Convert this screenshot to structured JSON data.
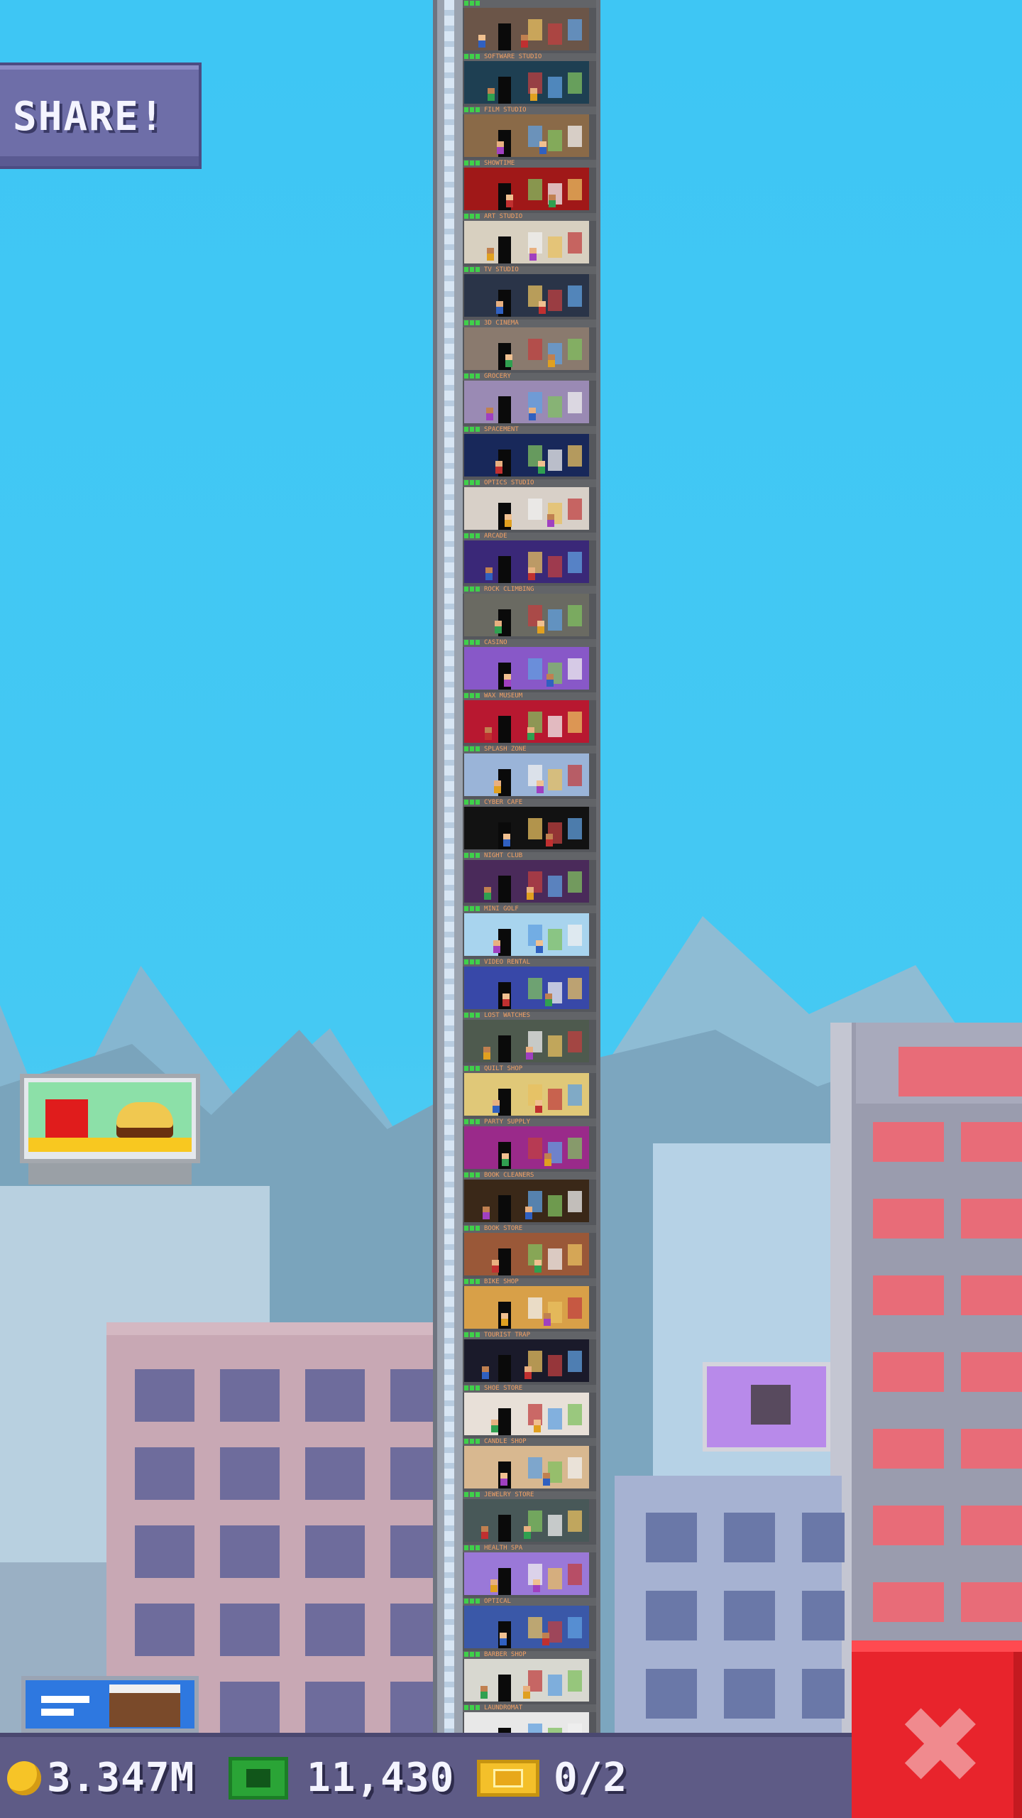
{
  "share_button": {
    "label": "SHARE!"
  },
  "tower": {
    "floors": [
      {
        "name": "",
        "color": "#6b5548"
      },
      {
        "name": "SOFTWARE STUDIO",
        "color": "#1e3f52"
      },
      {
        "name": "FILM STUDIO",
        "color": "#8a6a48"
      },
      {
        "name": "SHOWTIME",
        "color": "#a01818"
      },
      {
        "name": "ART STUDIO",
        "color": "#d8d0c0"
      },
      {
        "name": "TV STUDIO",
        "color": "#2a3448"
      },
      {
        "name": "3D CINEMA",
        "color": "#8a7a6e"
      },
      {
        "name": "GROCERY",
        "color": "#9a8ab4"
      },
      {
        "name": "SPACEMENT",
        "color": "#18285a"
      },
      {
        "name": "OPTICS STUDIO",
        "color": "#d8d0c8"
      },
      {
        "name": "ARCADE",
        "color": "#3a2878"
      },
      {
        "name": "ROCK CLIMBING",
        "color": "#6a6a62"
      },
      {
        "name": "CASINO",
        "color": "#8858c8"
      },
      {
        "name": "WAX MUSEUM",
        "color": "#b81830"
      },
      {
        "name": "SPLASH ZONE",
        "color": "#9ab4d8"
      },
      {
        "name": "CYBER CAFE",
        "color": "#121212"
      },
      {
        "name": "NIGHT CLUB",
        "color": "#4a2a5a"
      },
      {
        "name": "MINI GOLF",
        "color": "#a8d4ee"
      },
      {
        "name": "VIDEO RENTAL",
        "color": "#3848a8"
      },
      {
        "name": "LOST WATCHES",
        "color": "#4e5a4e"
      },
      {
        "name": "QUILT SHOP",
        "color": "#e0c878"
      },
      {
        "name": "PARTY SUPPLY",
        "color": "#9a2a8a"
      },
      {
        "name": "BOOK CLEANERS",
        "color": "#3a2818"
      },
      {
        "name": "BOOK STORE",
        "color": "#9a5838"
      },
      {
        "name": "BIKE SHOP",
        "color": "#d8a048"
      },
      {
        "name": "TOURIST TRAP",
        "color": "#1a1a2a"
      },
      {
        "name": "SHOE STORE",
        "color": "#e8e0d8"
      },
      {
        "name": "CANDLE SHOP",
        "color": "#d8b890"
      },
      {
        "name": "JEWELRY STORE",
        "color": "#485858"
      },
      {
        "name": "HEALTH SPA",
        "color": "#9a78d8"
      },
      {
        "name": "OPTICAL",
        "color": "#3a58a8"
      },
      {
        "name": "BARBER SHOP",
        "color": "#d8d8d0"
      },
      {
        "name": "LAUNDROMAT",
        "color": "#e8e8e8"
      }
    ]
  },
  "status_bar": {
    "coins": "3.347M",
    "cash": "11,430",
    "bux": "0/2"
  },
  "close_button": {
    "label": "✖"
  },
  "icons": {
    "coin": "coin-icon",
    "cash": "cash-icon",
    "bux": "bux-ticket-icon",
    "close": "close-icon"
  },
  "colors": {
    "sky": "#3ec6f4",
    "bar": "#5e5b86",
    "close": "#e8242c"
  }
}
